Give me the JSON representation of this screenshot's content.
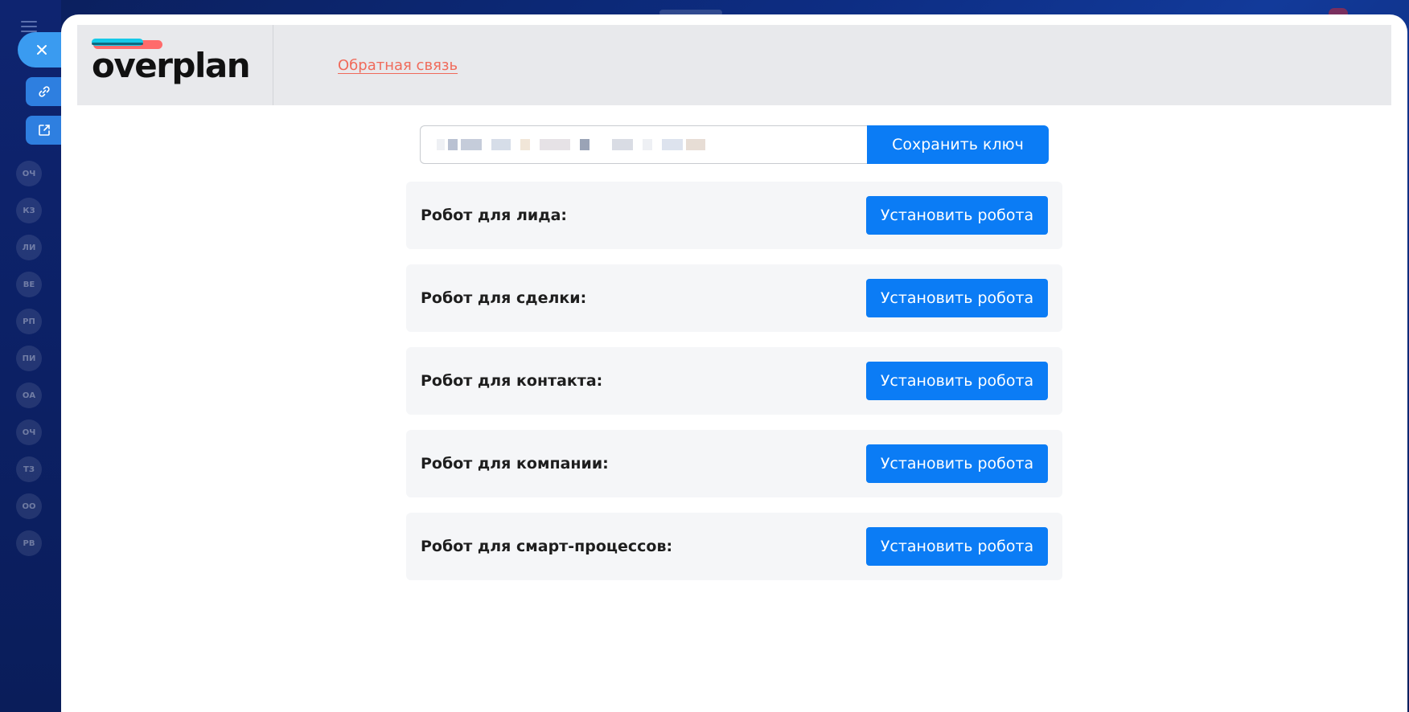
{
  "background": {
    "avatars": [
      "ОЧ",
      "КЗ",
      "ЛИ",
      "ВЕ",
      "РП",
      "ПИ",
      "ОА",
      "ОЧ",
      "ТЗ",
      "ОО",
      "РВ"
    ]
  },
  "header": {
    "logo_text": "overplan",
    "feedback_link": "Обратная связь"
  },
  "key": {
    "value": "",
    "save_label": "Сохранить ключ"
  },
  "robots": [
    {
      "label": "Робот для лида:",
      "button": "Установить робота"
    },
    {
      "label": "Робот для сделки:",
      "button": "Установить робота"
    },
    {
      "label": "Робот для контакта:",
      "button": "Установить робота"
    },
    {
      "label": "Робот для компании:",
      "button": "Установить робота"
    },
    {
      "label": "Робот для смарт-процессов:",
      "button": "Установить робота"
    }
  ],
  "colors": {
    "primary": "#0b7cf5",
    "feedback": "#f06a5a",
    "logo_red": "#ff6b6b",
    "logo_cyan": "#16c9e8"
  }
}
